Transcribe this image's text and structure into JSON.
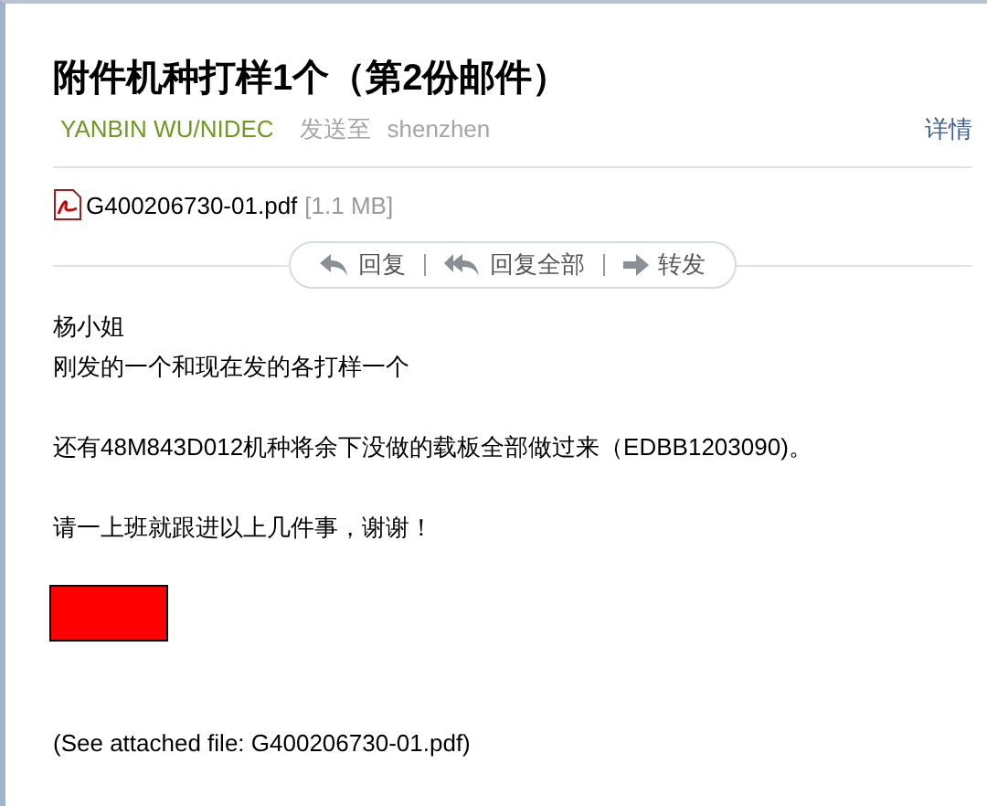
{
  "subject": "附件机种打样1个（第2份邮件）",
  "sender": "YANBIN WU/NIDEC",
  "sent_to_label": "发送至",
  "recipient": "shenzhen",
  "details_link": "详情",
  "attachment": {
    "name": "G400206730-01.pdf",
    "size": "[1.1 MB]"
  },
  "actions": [
    {
      "kind": "reply",
      "label": "回复"
    },
    {
      "kind": "reply_all",
      "label": "回复全部"
    },
    {
      "kind": "forward",
      "label": "转发"
    }
  ],
  "body": [
    {
      "lines": [
        "杨小姐",
        "刚发的一个和现在发的各打样一个"
      ]
    },
    {
      "lines": [
        "还有48M843D012机种将余下没做的载板全部做过来（EDBB1203090)。"
      ]
    },
    {
      "lines": [
        "请一上班就跟进以上几件事，谢谢！"
      ]
    }
  ],
  "footer": "(See attached file: G400206730-01.pdf)"
}
